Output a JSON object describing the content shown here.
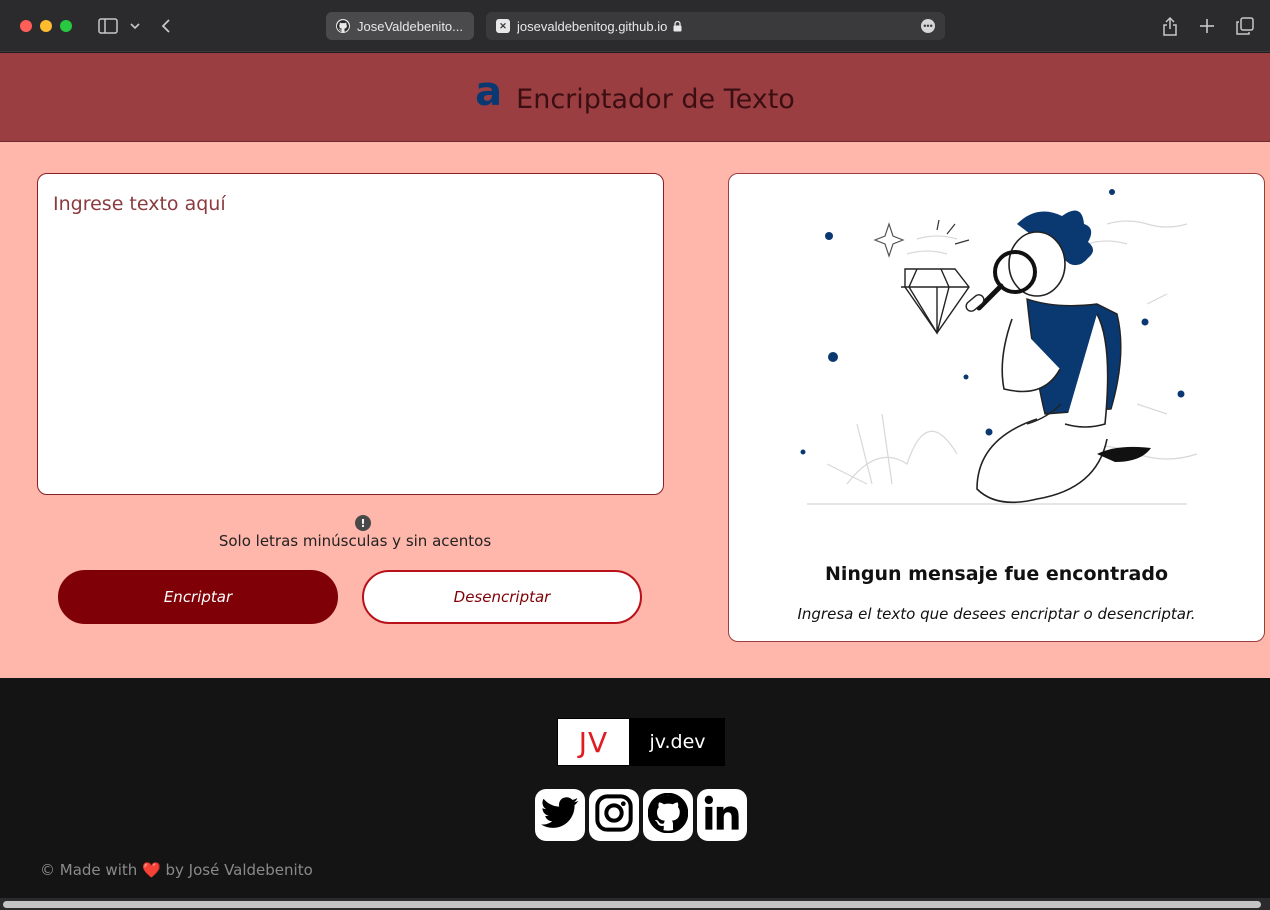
{
  "browser": {
    "tabs": [
      {
        "label": "JoseValdebenito..."
      },
      {
        "label": "josevaldebenitog.github.io"
      }
    ]
  },
  "header": {
    "logo": "a",
    "title": "Encriptador de Texto"
  },
  "input": {
    "placeholder": "Ingrese texto aquí"
  },
  "hint": {
    "icon": "!",
    "text": "Solo letras minúsculas y sin acentos"
  },
  "buttons": {
    "encrypt": "Encriptar",
    "decrypt": "Desencriptar"
  },
  "output": {
    "title": "Ningun mensaje fue encontrado",
    "subtitle": "Ingresa el texto que desees encriptar o desencriptar."
  },
  "footer": {
    "brand_logo": "JV",
    "brand_text": "jv.dev",
    "socials": [
      "twitter-icon",
      "instagram-icon",
      "github-icon",
      "linkedin-icon"
    ],
    "copyright_prefix": "© Made with",
    "copyright_suffix": "by José Valdebenito"
  },
  "colors": {
    "header": "#9a3e42",
    "main": "#ffb6ab",
    "accent": "#800008",
    "logo": "#0a3871",
    "footer": "#141414"
  }
}
